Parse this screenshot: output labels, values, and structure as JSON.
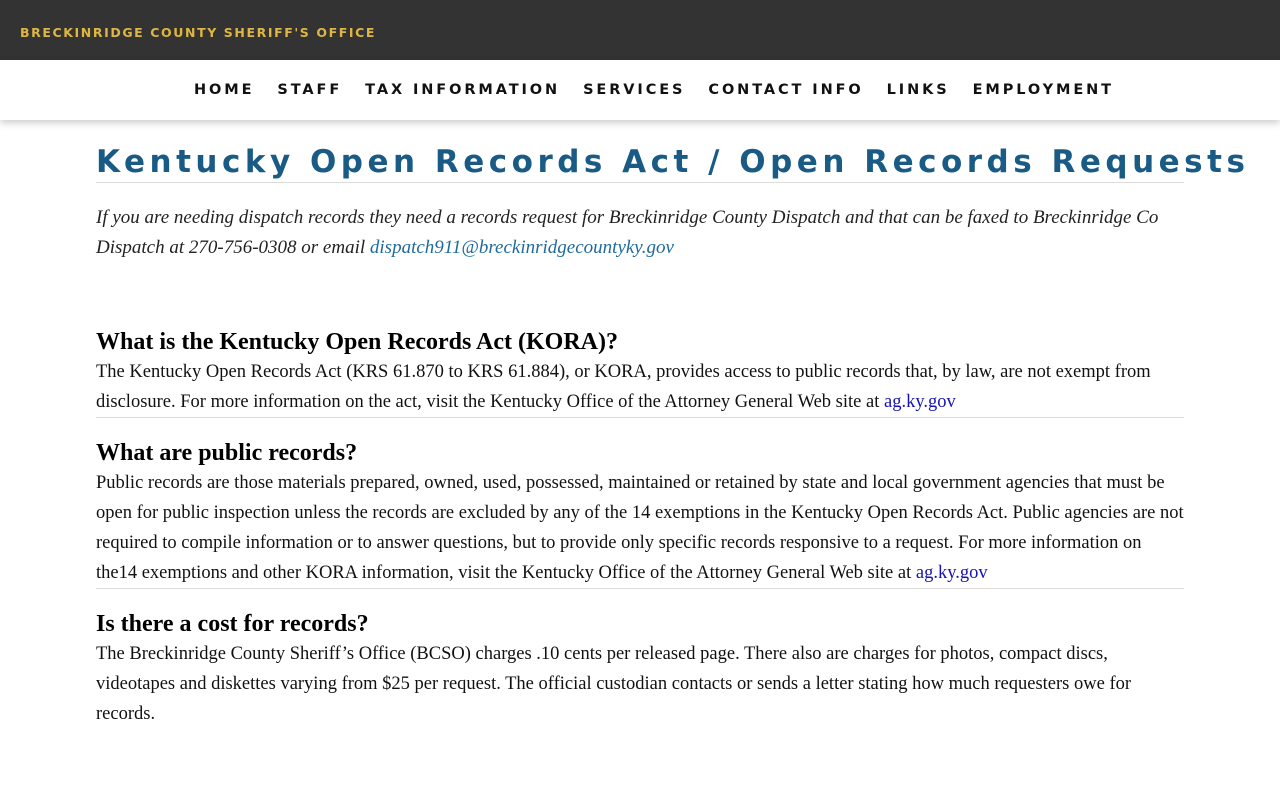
{
  "header": {
    "brand": "BRECKINRIDGE COUNTY SHERIFF'S OFFICE"
  },
  "nav": {
    "items": [
      {
        "label": "HOME"
      },
      {
        "label": "STAFF"
      },
      {
        "label": "TAX INFORMATION"
      },
      {
        "label": "SERVICES"
      },
      {
        "label": "CONTACT INFO"
      },
      {
        "label": "LINKS"
      },
      {
        "label": "EMPLOYMENT"
      }
    ]
  },
  "page": {
    "title": "Kentucky Open Records Act / Open Records Requests",
    "notice": {
      "text": "If you are needing dispatch records they need a records request for Breckinridge County Dispatch and that can be faxed to Breckinridge Co Dispatch at 270-756-0308 or email ",
      "email": "dispatch911@breckinridgecountyky.gov"
    },
    "sections": [
      {
        "heading": "What is the Kentucky Open Records Act (KORA)?",
        "body": "The Kentucky Open Records Act (KRS 61.870 to KRS 61.884), or KORA, provides access to public records that, by law, are not exempt from disclosure. For more information on the act, visit the Kentucky Office of the Attorney General Web site at ",
        "link": "ag.ky.gov"
      },
      {
        "heading": "What are public records?",
        "body": "Public records are those materials prepared, owned, used, possessed, maintained or retained by state and local government agencies that must be open for public inspection unless the records are excluded by any of the 14 exemptions in the Kentucky Open Records Act. Public agencies are not required to compile information or to answer questions, but to provide only specific records responsive to a request. For more information on the14 exemptions and other KORA information, visit the Kentucky Office of the Attorney General Web site at ",
        "link": "ag.ky.gov"
      },
      {
        "heading": "Is there a cost for records?",
        "body": "The Breckinridge County Sheriff’s Office (BCSO) charges .10 cents per released page. There also are charges for photos, compact discs, videotapes and diskettes varying from $25 per request. The official custodian contacts or sends a letter stating how much requesters owe for records."
      }
    ]
  },
  "colors": {
    "topbar": "#333333",
    "brand": "#e0b643",
    "title": "#1a5b85",
    "email_link": "#1f6a9c",
    "body_link": "#1414b4"
  }
}
